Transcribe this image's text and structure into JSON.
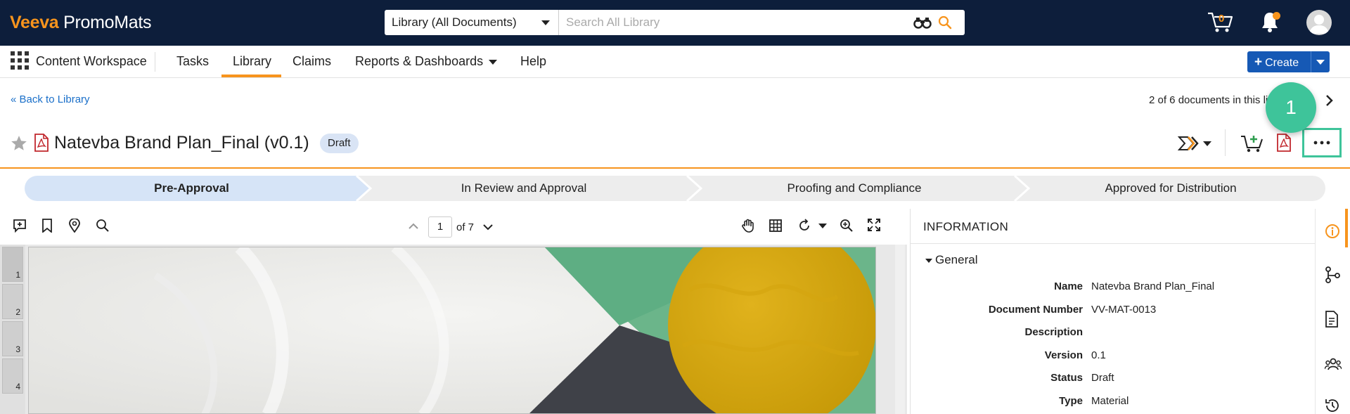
{
  "app": {
    "brand": "Veeva",
    "product": "PromoMats"
  },
  "search": {
    "scope": "Library (All Documents)",
    "placeholder": "Search All Library"
  },
  "header": {
    "cart_count": "0"
  },
  "nav": {
    "workspace": "Content Workspace",
    "items": [
      "Tasks",
      "Library",
      "Claims",
      "Reports & Dashboards",
      "Help"
    ],
    "active": "Library",
    "create_label": "Create"
  },
  "doc": {
    "back_label": "Back to Library",
    "position": "2 of 6 documents in this li",
    "title": "Natevba Brand Plan_Final (v0.1)",
    "status_badge": "Draft"
  },
  "callout": {
    "number": "1"
  },
  "stages": [
    "Pre-Approval",
    "In Review and Approval",
    "Proofing and Compliance",
    "Approved for Distribution"
  ],
  "active_stage": "Pre-Approval",
  "viewer": {
    "page": "1",
    "of_pages": "of 7",
    "thumb_pages": [
      "1",
      "2",
      "3",
      "4"
    ]
  },
  "info": {
    "title": "INFORMATION",
    "section": "General",
    "fields": [
      {
        "label": "Name",
        "value": "Natevba Brand Plan_Final"
      },
      {
        "label": "Document Number",
        "value": "VV-MAT-0013"
      },
      {
        "label": "Description",
        "value": ""
      },
      {
        "label": "Version",
        "value": "0.1"
      },
      {
        "label": "Status",
        "value": "Draft"
      },
      {
        "label": "Type",
        "value": "Material"
      }
    ]
  },
  "colors": {
    "accent": "#f7941d",
    "navy": "#0d1e3b",
    "primary": "#1659b5",
    "callout": "#3ec49a",
    "active_stage": "#d6e4f7"
  }
}
